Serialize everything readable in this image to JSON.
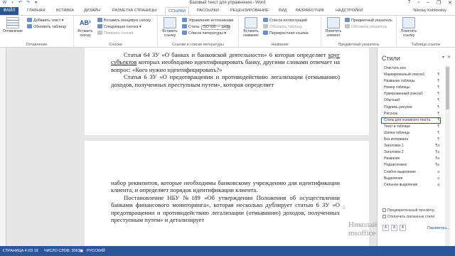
{
  "window": {
    "title": "Базовый текст для упражнения - Word",
    "user": "Nikolay Koldovskiy"
  },
  "tabs": {
    "file": "ФАЙЛ",
    "items": [
      "ГЛАВНАЯ",
      "ВСТАВКА",
      "ДИЗАЙН",
      "РАЗМЕТКА СТРАНИЦЫ",
      "ССЫЛКИ",
      "РАССЫЛКИ",
      "РЕЦЕНЗИРОВАНИЕ",
      "ВИД",
      "РАЗРАБОТЧИК",
      "НАДСТРОЙКИ"
    ],
    "active": "ССЫЛКИ"
  },
  "ribbon": {
    "toc": {
      "big_label": "Оглавление",
      "add_text": "Добавить текст",
      "update_table": "Обновить таблицу",
      "group_label": "Оглавление"
    },
    "footnotes": {
      "big_label": "Вставить сноску",
      "insert_endnote": "Вставить концевую сноску",
      "next_footnote": "Следующая сноска",
      "show_notes": "Показать сноски",
      "group_label": "Сноски"
    },
    "citations": {
      "big_label": "Вставить ссылку",
      "manage_sources": "Управление источниками",
      "style_label": "Стиль:",
      "style_value": "ISO 690 — цифр",
      "bibliography": "Список литературы",
      "group_label": "Ссылки и списки литературы"
    },
    "captions": {
      "big_label": "Вставить название",
      "insert_tof": "Список иллюстраций",
      "update_table": "Обновить таблицу",
      "cross_reference": "Перекрестная ссылка",
      "group_label": "Названия"
    },
    "index": {
      "big_label": "Пометить элемент",
      "insert_index": "Предметный указатель",
      "update_index": "Обновить указатель",
      "group_label": "Предметный указатель"
    },
    "toa": {
      "big_label": "Пометить ссылку",
      "group_label": "Таблица ссылок"
    }
  },
  "document": {
    "page1": {
      "p1": "Статья 64 ЗУ «О банках и банковской деятельности» 6 которая определяет ",
      "p1_underlined": "круг субъектов",
      "p1_rest": " которых необходимо идентифицировать банку, другими словами отвечает на вопрос: «Кого нужно идентифицировать?»",
      "p2": "Статья 6 ЗУ «О предотвращении и противодействию легализации (отмыванию) доходов, полученных преступным путем», которая определяет"
    },
    "page2": {
      "page_number": "5",
      "p1": "набор реквизитов, которые необходимы банковскому учреждению для идентификации клиента, и определяет порядок идентификации клиента.",
      "p2": "Постановление НБУ №189 «Об утверждении Положения об осуществлении банками финансового мониторинга», которая несколько дублирует статью 6 ЗУ «О предотвращении и противодействию легализации (отмыванию) доходов, полученных преступным путем» и детализирует"
    }
  },
  "styles_pane": {
    "title": "Стили",
    "items": [
      {
        "name": "Очистить все",
        "mark": ""
      },
      {
        "name": "Маркированный список1",
        "mark": "¶"
      },
      {
        "name": "Название таблицы",
        "mark": "¶"
      },
      {
        "name": "Номер таблицы",
        "mark": "¶"
      },
      {
        "name": "Нумерованный список1",
        "mark": "¶"
      },
      {
        "name": "Обычный",
        "mark": "¶"
      },
      {
        "name": "Подпись рисунка",
        "mark": "¶"
      },
      {
        "name": "Рисунок",
        "mark": "¶"
      },
      {
        "name": "Стиль для основного текста",
        "mark": "¶"
      },
      {
        "name": "Текст в таблице",
        "mark": "¶"
      },
      {
        "name": "Шапка таблицы",
        "mark": "¶"
      },
      {
        "name": "Без интервала",
        "mark": "¶"
      },
      {
        "name": "Заголовок 1",
        "mark": "¶a"
      },
      {
        "name": "Заголовок 2",
        "mark": "¶a"
      },
      {
        "name": "Название",
        "mark": "¶a"
      },
      {
        "name": "Подзаголовок",
        "mark": "¶a"
      },
      {
        "name": "Слабое выделение",
        "mark": "a"
      },
      {
        "name": "Выделение",
        "mark": "a"
      },
      {
        "name": "Сильное выделение",
        "mark": "a"
      }
    ],
    "selected_index": 8,
    "preview_label": "Предварительный просмотр",
    "disable_linked_label": "Отключить связанные стили",
    "options_label": "Параметры..."
  },
  "statusbar": {
    "page": "СТРАНИЦА 4 ИЗ 18",
    "words": "ЧИСЛО СЛОВ: 3063",
    "language": "РУССКИЙ"
  },
  "watermark": {
    "line1": "Николай Колдовский",
    "line2": "msoffice-prowork.com"
  },
  "colors": {
    "accent": "#2b579a"
  }
}
